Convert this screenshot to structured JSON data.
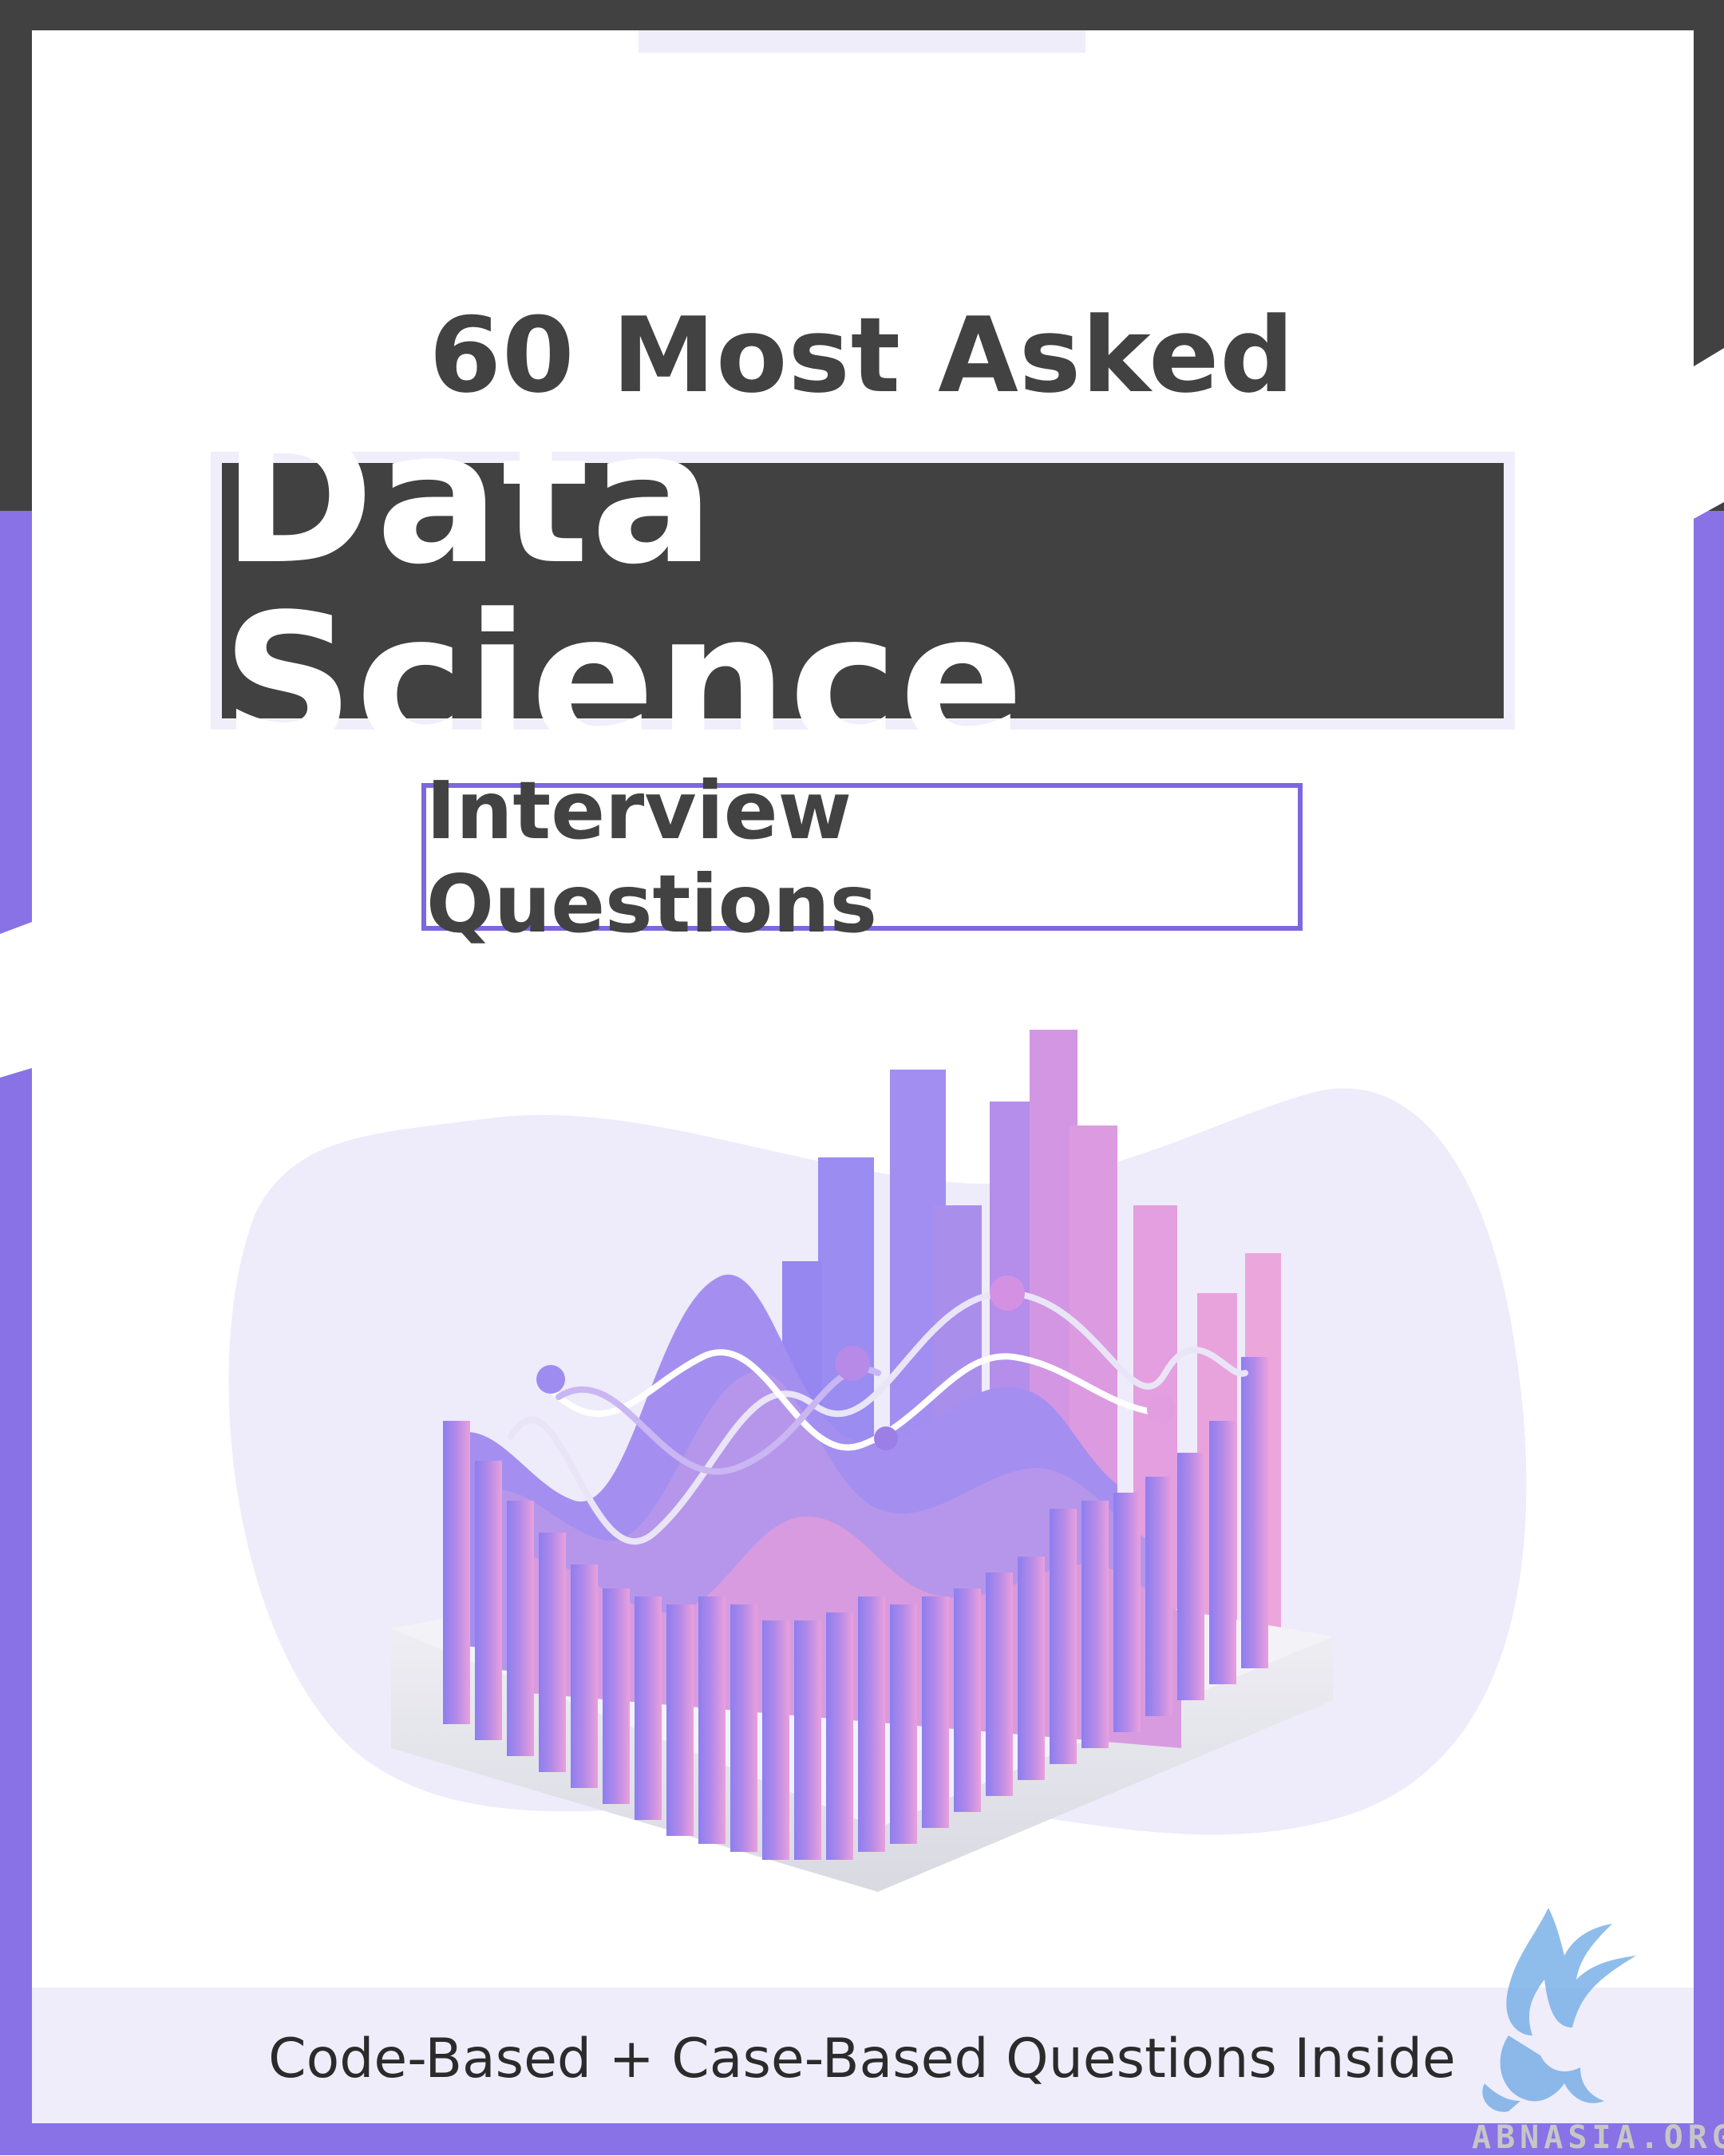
{
  "cover": {
    "title_top": "60 Most Asked",
    "title_main": "Data Science",
    "subtitle": "Interview Questions",
    "tagline": "Code-Based + Case-Based Questions Inside"
  },
  "watermark": {
    "text": "ABNASIA.ORG"
  },
  "colors": {
    "dark": "#414141",
    "accent_purple": "#8872e6",
    "light_lavender": "#f0edfb",
    "white": "#ffffff"
  },
  "icons": [
    "bar-chart-illustration-icon",
    "griffin-logo-icon"
  ]
}
